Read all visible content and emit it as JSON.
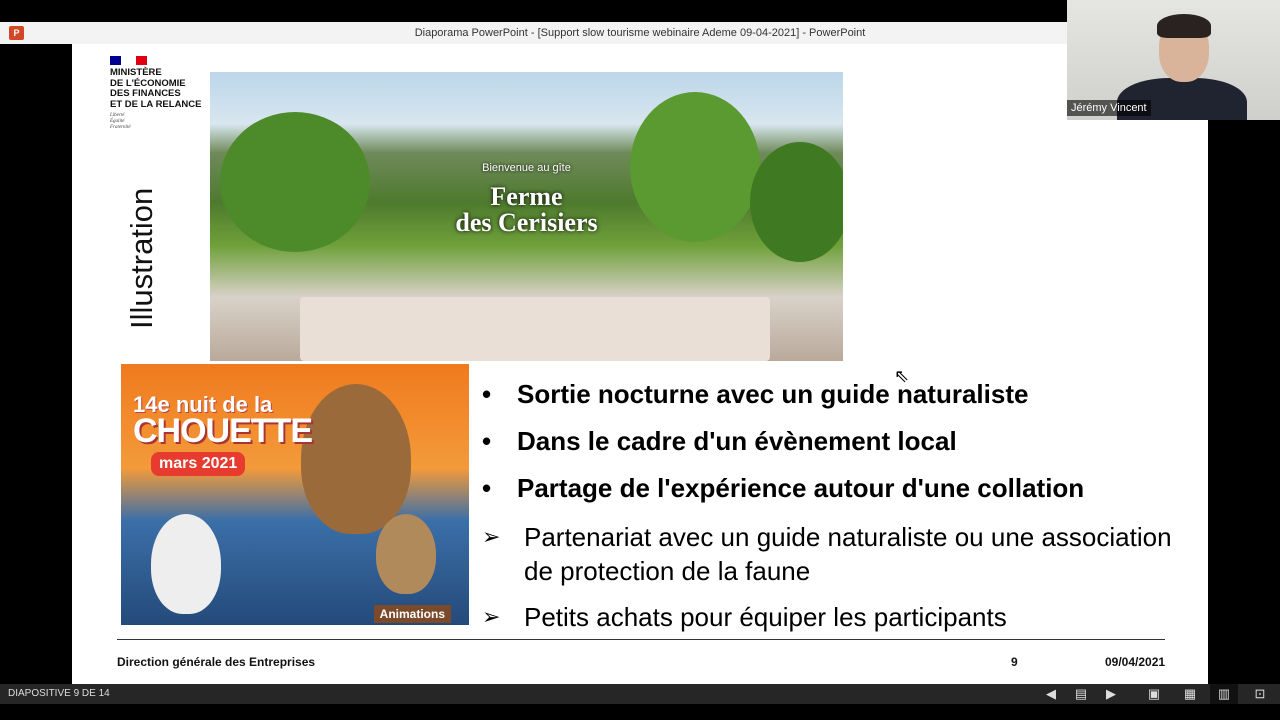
{
  "window": {
    "title": "Diaporama PowerPoint - [Support slow tourisme webinaire Ademe 09-04-2021] - PowerPoint",
    "app_icon": "P"
  },
  "slide": {
    "logo": {
      "name": "MINISTÈRE DE L'ÉCONOMIE DES FINANCES ET DE LA RELANCE",
      "lines": [
        "MINISTÈRE",
        "DE L'ÉCONOMIE",
        "DES FINANCES",
        "ET DE LA RELANCE"
      ],
      "motto": [
        "Liberté",
        "Égalité",
        "Fraternité"
      ]
    },
    "vertical_title": "Illustration",
    "photo1": {
      "subtitle": "Bienvenue au gîte",
      "title_l1": "Ferme",
      "title_l2": "des Cerisiers"
    },
    "photo2": {
      "l1": "14e nuit de la",
      "l2": "CHOUETTE",
      "l3": "mars 2021",
      "l4": "Animations"
    },
    "bullets": [
      "Sortie nocturne avec un guide naturaliste",
      "Dans le cadre d'un évènement local",
      "Partage de l'expérience autour d'une collation"
    ],
    "arrows": [
      "Partenariat avec un guide naturaliste ou une association de protection de la faune",
      "Petits achats pour équiper les participants"
    ],
    "footer": {
      "org": "Direction générale des Entreprises",
      "page": "9",
      "date": "09/04/2021"
    }
  },
  "status": {
    "slide_label": "DIAPOSITIVE 9 DE 14"
  },
  "webcam": {
    "name": "Jérémy Vincent"
  }
}
